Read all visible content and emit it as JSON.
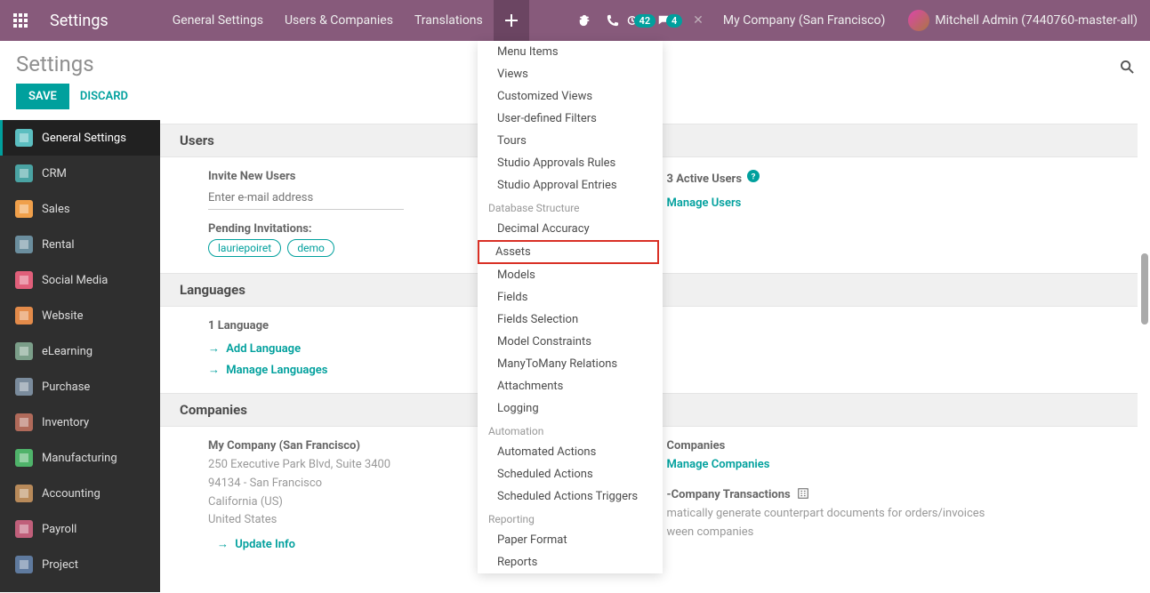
{
  "topbar": {
    "brand": "Settings",
    "menu": [
      "General Settings",
      "Users & Companies",
      "Translations"
    ],
    "badge1": "42",
    "badge2": "4",
    "company": "My Company (San Francisco)",
    "user": "Mitchell Admin (7440760-master-all)"
  },
  "subheader": {
    "title": "Settings",
    "save": "SAVE",
    "discard": "DISCARD"
  },
  "sidebar": [
    {
      "label": "General Settings",
      "color": "#5bbec0",
      "active": true
    },
    {
      "label": "CRM",
      "color": "#4aa3a3"
    },
    {
      "label": "Sales",
      "color": "#f0a04b"
    },
    {
      "label": "Rental",
      "color": "#6b8e9e"
    },
    {
      "label": "Social Media",
      "color": "#e05f7a"
    },
    {
      "label": "Website",
      "color": "#e38b4a"
    },
    {
      "label": "eLearning",
      "color": "#7b9e89"
    },
    {
      "label": "Purchase",
      "color": "#7a8b9c"
    },
    {
      "label": "Inventory",
      "color": "#b06a5a"
    },
    {
      "label": "Manufacturing",
      "color": "#4fb36a"
    },
    {
      "label": "Accounting",
      "color": "#b88a5a"
    },
    {
      "label": "Payroll",
      "color": "#c05f7a"
    },
    {
      "label": "Project",
      "color": "#5f7a9e"
    }
  ],
  "sections": {
    "users": {
      "header": "Users",
      "invite_label": "Invite New Users",
      "invite_placeholder": "Enter e-mail address",
      "pending_label": "Pending Invitations:",
      "tags": [
        "lauriepoiret",
        "demo"
      ],
      "active_users": "3 Active Users",
      "manage_users": "Manage Users"
    },
    "languages": {
      "header": "Languages",
      "count": "1 Language",
      "add": "Add Language",
      "manage": "Manage Languages"
    },
    "companies": {
      "header": "Companies",
      "name": "My Company (San Francisco)",
      "addr1": "250 Executive Park Blvd, Suite 3400",
      "addr2": "94134 - San Francisco",
      "addr3": "California (US)",
      "addr4": "United States",
      "update": "Update Info",
      "companies_label": "Companies",
      "manage_companies": "Manage Companies",
      "inter_label": "-Company Transactions",
      "inter_desc1": "matically generate counterpart documents for orders/invoices",
      "inter_desc2": "ween companies"
    }
  },
  "dropdown": {
    "items": [
      {
        "type": "item",
        "label": "Menu Items"
      },
      {
        "type": "item",
        "label": "Views"
      },
      {
        "type": "item",
        "label": "Customized Views"
      },
      {
        "type": "item",
        "label": "User-defined Filters"
      },
      {
        "type": "item",
        "label": "Tours"
      },
      {
        "type": "item",
        "label": "Studio Approvals Rules"
      },
      {
        "type": "item",
        "label": "Studio Approval Entries"
      },
      {
        "type": "header",
        "label": "Database Structure"
      },
      {
        "type": "item",
        "label": "Decimal Accuracy"
      },
      {
        "type": "highlight",
        "label": "Assets"
      },
      {
        "type": "item",
        "label": "Models"
      },
      {
        "type": "item",
        "label": "Fields"
      },
      {
        "type": "item",
        "label": "Fields Selection"
      },
      {
        "type": "item",
        "label": "Model Constraints"
      },
      {
        "type": "item",
        "label": "ManyToMany Relations"
      },
      {
        "type": "item",
        "label": "Attachments"
      },
      {
        "type": "item",
        "label": "Logging"
      },
      {
        "type": "header",
        "label": "Automation"
      },
      {
        "type": "item",
        "label": "Automated Actions"
      },
      {
        "type": "item",
        "label": "Scheduled Actions"
      },
      {
        "type": "item",
        "label": "Scheduled Actions Triggers"
      },
      {
        "type": "header",
        "label": "Reporting"
      },
      {
        "type": "item",
        "label": "Paper Format"
      },
      {
        "type": "item",
        "label": "Reports"
      }
    ]
  }
}
